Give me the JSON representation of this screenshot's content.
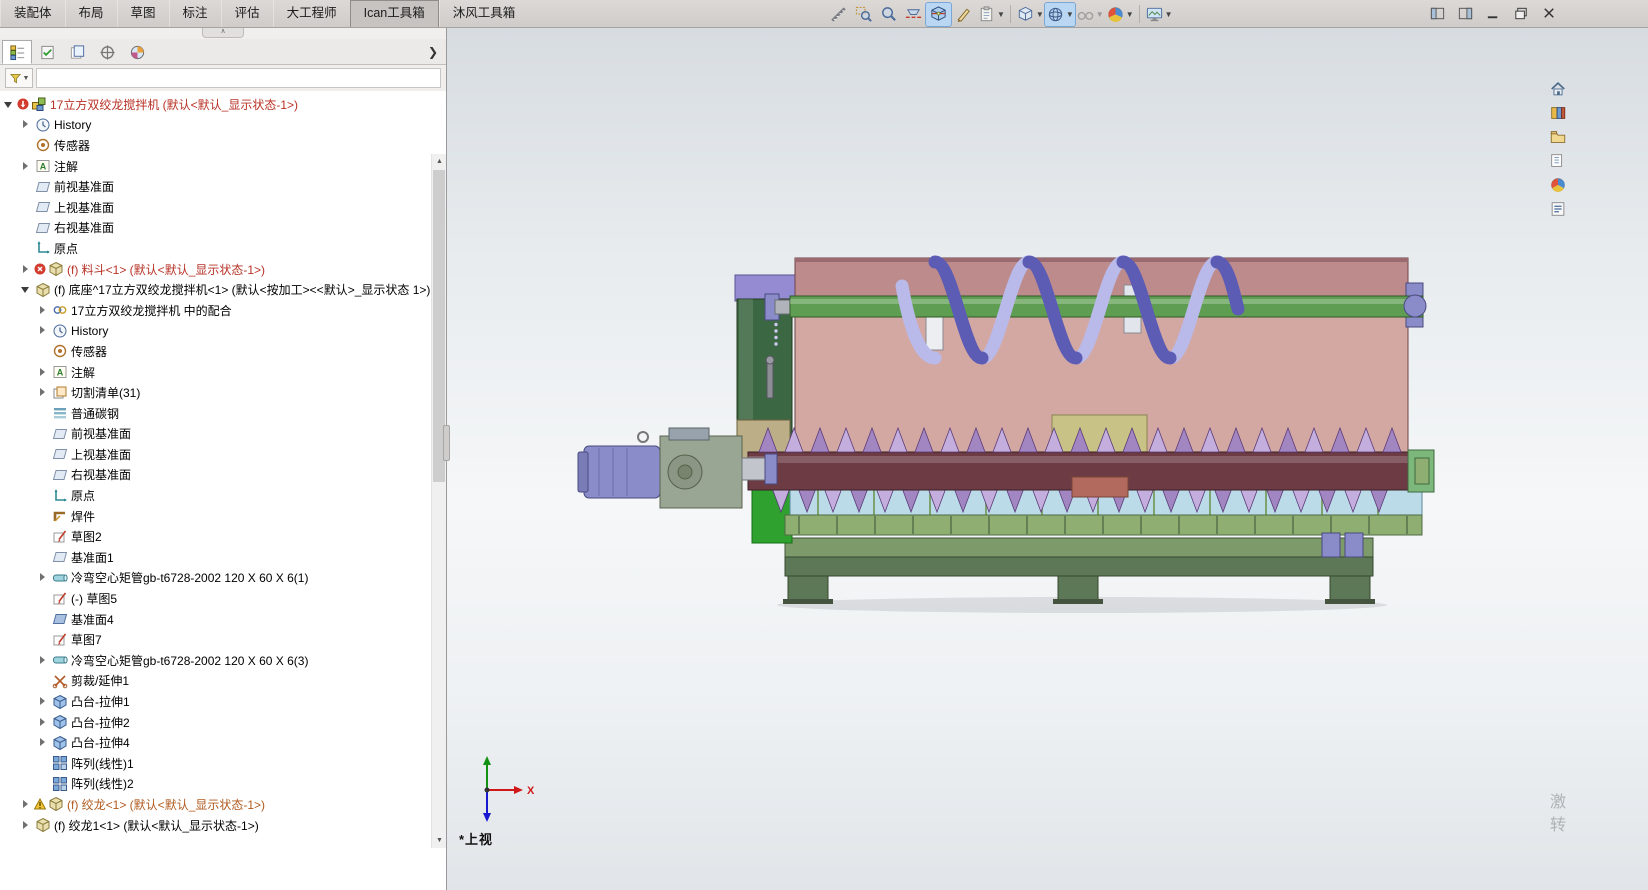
{
  "menubar": {
    "tabs": [
      "装配体",
      "布局",
      "草图",
      "标注",
      "评估",
      "大工程师",
      "Ican工具箱",
      "沐风工具箱"
    ],
    "active_tab": "Ican工具箱"
  },
  "hud_toolbar": {
    "items": [
      {
        "name": "measure"
      },
      {
        "name": "zoom-area"
      },
      {
        "name": "magnifier"
      },
      {
        "name": "section-cut"
      },
      {
        "name": "section-view",
        "pressed": true
      },
      {
        "name": "annotation-pen"
      },
      {
        "name": "view-palette",
        "dropdown": true
      },
      {
        "type": "sep"
      },
      {
        "name": "view-orientation",
        "dropdown": true
      },
      {
        "name": "display-style",
        "pressed": true,
        "dropdown": true
      },
      {
        "name": "hide-show",
        "disabled": true,
        "dropdown": true
      },
      {
        "name": "edit-appearance",
        "dropdown": true
      },
      {
        "type": "sep"
      },
      {
        "name": "apply-scene",
        "dropdown": true
      }
    ]
  },
  "window_controls": [
    {
      "name": "collapse-pane-left"
    },
    {
      "name": "collapse-pane-right"
    },
    {
      "name": "minimize"
    },
    {
      "name": "restore"
    },
    {
      "name": "close"
    }
  ],
  "panel": {
    "tabs": [
      {
        "name": "featuremanager-tree",
        "active": true
      },
      {
        "name": "propertymanager",
        "active": false
      },
      {
        "name": "configurationmanager",
        "active": false
      },
      {
        "name": "dimxpertmanager",
        "active": false
      },
      {
        "name": "displaymanager",
        "active": false
      }
    ],
    "flyout_glyph": "❯",
    "filter_value": "",
    "tree": {
      "items": [
        {
          "label": "17立方双绞龙搅拌机 (默认<默认_显示状态-1>)",
          "depth": 0,
          "arrow": "expanded",
          "icon": "assembly",
          "badge": "red-arrow",
          "color": "#b83226"
        },
        {
          "label": "History",
          "depth": 1,
          "arrow": "collapsed",
          "icon": "history"
        },
        {
          "label": "传感器",
          "depth": 1,
          "icon": "sensor"
        },
        {
          "label": "注解",
          "depth": 1,
          "arrow": "collapsed",
          "icon": "note"
        },
        {
          "label": "前视基准面",
          "depth": 1,
          "icon": "plane"
        },
        {
          "label": "上视基准面",
          "depth": 1,
          "icon": "plane"
        },
        {
          "label": "右视基准面",
          "depth": 1,
          "icon": "plane"
        },
        {
          "label": "原点",
          "depth": 1,
          "icon": "origin"
        },
        {
          "label": "(f) 料斗<1> (默认<默认_显示状态-1>)",
          "depth": 1,
          "arrow": "collapsed",
          "icon": "part",
          "badge": "error",
          "color": "#b83226"
        },
        {
          "label": "(f) 底座^17立方双绞龙搅拌机<1> (默认<按加工><<默认>_显示状态 1>)",
          "depth": 1,
          "arrow": "expanded",
          "icon": "part"
        },
        {
          "label": "17立方双绞龙搅拌机 中的配合",
          "depth": 2,
          "arrow": "collapsed",
          "icon": "mates"
        },
        {
          "label": "History",
          "depth": 2,
          "arrow": "collapsed",
          "icon": "history"
        },
        {
          "label": "传感器",
          "depth": 2,
          "icon": "sensor"
        },
        {
          "label": "注解",
          "depth": 2,
          "arrow": "collapsed",
          "icon": "note"
        },
        {
          "label": "切割清单(31)",
          "depth": 2,
          "arrow": "collapsed",
          "icon": "cutlist"
        },
        {
          "label": "普通碳钢",
          "depth": 2,
          "icon": "material"
        },
        {
          "label": "前视基准面",
          "depth": 2,
          "icon": "plane"
        },
        {
          "label": "上视基准面",
          "depth": 2,
          "icon": "plane"
        },
        {
          "label": "右视基准面",
          "depth": 2,
          "icon": "plane"
        },
        {
          "label": "原点",
          "depth": 2,
          "icon": "origin"
        },
        {
          "label": "焊件",
          "depth": 2,
          "icon": "weldment"
        },
        {
          "label": "草图2",
          "depth": 2,
          "icon": "sketch"
        },
        {
          "label": "基准面1",
          "depth": 2,
          "icon": "plane"
        },
        {
          "label": "冷弯空心矩管gb-t6728-2002 120 X 60 X 6(1)",
          "depth": 2,
          "arrow": "collapsed",
          "icon": "pipe"
        },
        {
          "label": "(-) 草图5",
          "depth": 2,
          "icon": "sketch"
        },
        {
          "label": "基准面4",
          "depth": 2,
          "icon": "plane-solid"
        },
        {
          "label": "草图7",
          "depth": 2,
          "icon": "sketch"
        },
        {
          "label": "冷弯空心矩管gb-t6728-2002 120 X 60 X 6(3)",
          "depth": 2,
          "arrow": "collapsed",
          "icon": "pipe"
        },
        {
          "label": "剪裁/延伸1",
          "depth": 2,
          "icon": "trim"
        },
        {
          "label": "凸台-拉伸1",
          "depth": 2,
          "arrow": "collapsed",
          "icon": "boss"
        },
        {
          "label": "凸台-拉伸2",
          "depth": 2,
          "arrow": "collapsed",
          "icon": "boss"
        },
        {
          "label": "凸台-拉伸4",
          "depth": 2,
          "arrow": "collapsed",
          "icon": "boss"
        },
        {
          "label": "阵列(线性)1",
          "depth": 2,
          "icon": "pattern"
        },
        {
          "label": "阵列(线性)2",
          "depth": 2,
          "icon": "pattern"
        },
        {
          "label": "(f) 绞龙<1> (默认<默认_显示状态-1>)",
          "depth": 1,
          "arrow": "collapsed",
          "icon": "part",
          "badge": "warn",
          "color": "#b05a1e"
        },
        {
          "label": "(f) 绞龙1<1> (默认<默认_显示状态-1>)",
          "depth": 1,
          "arrow": "collapsed",
          "icon": "part"
        }
      ]
    }
  },
  "viewport": {
    "view_label": "*上视",
    "triad_x_label": "X",
    "watermark_chars": [
      "激",
      "转"
    ],
    "model_colors": {
      "body_pink": "#d3a8a2",
      "body_top": "#bd8b8c",
      "shaft_green": "#5f9e52",
      "auger_front": "#5c5cb4",
      "auger_back": "#b9b9ea",
      "tower_green": "#3c6743",
      "tower_cap": "#948bd3",
      "khaki": "#c9c287",
      "khaki_dark": "#bcae86",
      "bottom_shaft": "#6d3b44",
      "teeth_purple": "#a286c2",
      "teeth_light": "#c4aede",
      "trough_blue": "#badbe7",
      "band_green": "#8fae72",
      "frame_green": "#5d7856",
      "frame_light": "#7d9a6b",
      "frame_dark": "#44543e",
      "motor_purple": "#8a8cc9",
      "gearbox_gray": "#9aa694",
      "coupling_gray": "#c2c6cc",
      "pillar_green": "#2fa12f",
      "bracket_green": "#7cb87c",
      "bearing_red": "#b26a5e"
    }
  },
  "task_pane": {
    "tabs": [
      {
        "name": "home"
      },
      {
        "name": "solidworks-resources"
      },
      {
        "name": "design-library"
      },
      {
        "name": "file-explorer"
      },
      {
        "name": "appearances-scenes"
      },
      {
        "name": "custom-properties"
      }
    ]
  }
}
